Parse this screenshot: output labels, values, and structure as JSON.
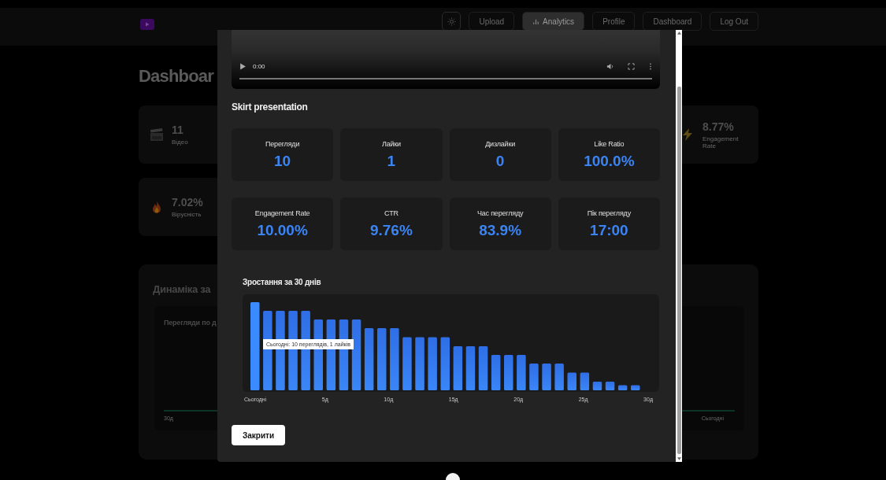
{
  "header": {
    "nav": [
      {
        "label": "Upload",
        "selected": false,
        "kind": "plain"
      },
      {
        "label": "Analytics",
        "selected": true,
        "kind": "chart"
      },
      {
        "label": "Profile",
        "selected": false,
        "kind": "plain"
      },
      {
        "label": "Dashboard",
        "selected": false,
        "kind": "plain"
      },
      {
        "label": "Log Out",
        "selected": false,
        "kind": "plain"
      }
    ]
  },
  "background": {
    "title": "Dashboar",
    "cards_left": [
      {
        "kind": "clapper",
        "value": "11",
        "label": "Відео"
      },
      {
        "kind": "fire",
        "value": "7.02%",
        "label": "Вірусність"
      }
    ],
    "card_right": {
      "kind": "lightning",
      "value": "8.77%",
      "label": "Engagement Rate"
    },
    "section_title": "Динаміка за",
    "chart_title": "Перегляди по д",
    "axis_start": "30д",
    "axis_end": "Сьогодні"
  },
  "modal": {
    "video": {
      "time": "0:00"
    },
    "title": "Skirt presentation",
    "stats": [
      {
        "label": "Перегляди",
        "value": "10"
      },
      {
        "label": "Лайки",
        "value": "1"
      },
      {
        "label": "Дизлайки",
        "value": "0"
      },
      {
        "label": "Like Ratio",
        "value": "100.0%"
      },
      {
        "label": "Engagement Rate",
        "value": "10.00%"
      },
      {
        "label": "CTR",
        "value": "9.76%"
      },
      {
        "label": "Час перегляду",
        "value": "83.9%"
      },
      {
        "label": "Пік перегляду",
        "value": "17:00"
      }
    ],
    "chart": {
      "title": "Зростання за 30 днів",
      "x_labels": [
        "Сьогодні",
        "5д",
        "10д",
        "15д",
        "20д",
        "25д",
        "30д"
      ],
      "tooltip": "Сьогодні: 10 переглядів, 1 лайків"
    },
    "close_button": "Закрити"
  }
}
